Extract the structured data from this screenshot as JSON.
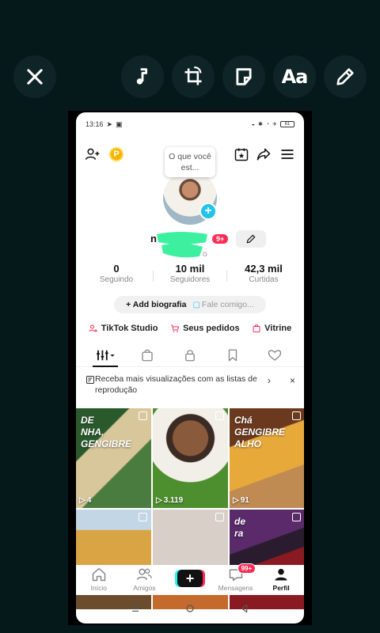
{
  "editor_toolbar": {
    "close": "close-icon",
    "music": "music-note-icon",
    "crop": "crop-rotate-icon",
    "sticker": "sticker-icon",
    "text_label": "Aa",
    "draw": "pencil-icon"
  },
  "status_bar": {
    "time": "13:16",
    "battery": "61"
  },
  "profile": {
    "bubble_text": "O que você est...",
    "name_visible": "n",
    "name_tail": "o",
    "notification_badge": "9+",
    "handle_tail": "o"
  },
  "stats": [
    {
      "value": "0",
      "label": "Seguindo"
    },
    {
      "value": "10 mil",
      "label": "Seguidores"
    },
    {
      "value": "42,3 mil",
      "label": "Curtidas"
    }
  ],
  "bio": {
    "add_label": "+ Add biografia",
    "fale_label": "Fale comigo..."
  },
  "links": [
    {
      "label": "TikTok Studio",
      "icon": "studio-icon",
      "color": "#fe2c55"
    },
    {
      "label": "Seus pedidos",
      "icon": "cart-icon",
      "color": "#fe2c55"
    },
    {
      "label": "Vitrine",
      "icon": "bag-icon",
      "color": "#fe2c55"
    }
  ],
  "tabs": [
    "videos-grid-icon",
    "bag-icon",
    "lock-icon",
    "bookmark-icon",
    "heart-icon"
  ],
  "playlist_banner": {
    "text": "Receba mais visualizações com as listas de reprodução"
  },
  "videos": [
    {
      "views": "4",
      "title": "DE\nNHA,\nGENGIBRE"
    },
    {
      "views": "3.119",
      "title": ""
    },
    {
      "views": "91",
      "title": "Chá\nGENGIBRE\nALHO"
    },
    {
      "views": "",
      "title": ""
    },
    {
      "views": "",
      "title": ""
    },
    {
      "views": "",
      "title": "de\nra"
    }
  ],
  "bottom_nav": [
    {
      "label": "Início",
      "icon": "home-icon"
    },
    {
      "label": "Amigos",
      "icon": "friends-icon"
    },
    {
      "label": "+",
      "icon": "create-icon"
    },
    {
      "label": "Mensagens",
      "icon": "inbox-icon",
      "badge": "99+"
    },
    {
      "label": "Perfil",
      "icon": "profile-icon"
    }
  ],
  "colors": {
    "background": "#06191a",
    "accent": "#fe2c55",
    "cyan": "#20c4e8",
    "coin": "#f6b400"
  }
}
